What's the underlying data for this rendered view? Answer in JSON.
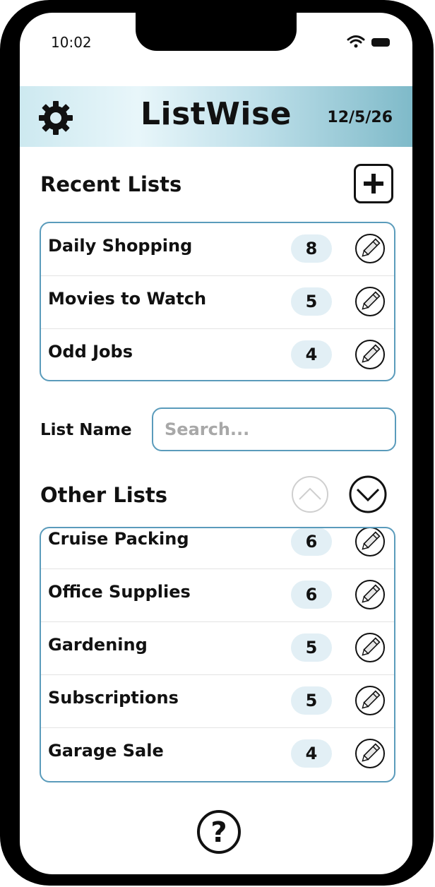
{
  "status_bar": {
    "time": "10:02"
  },
  "header": {
    "title": "ListWise",
    "date": "12/5/26",
    "settings_icon": "gear-icon"
  },
  "recent": {
    "title": "Recent Lists",
    "items": [
      {
        "label": "Daily Shopping",
        "count": "8"
      },
      {
        "label": "Movies to Watch",
        "count": "5"
      },
      {
        "label": "Odd Jobs",
        "count": "4"
      }
    ]
  },
  "filter": {
    "label": "List Name",
    "placeholder": "Search..."
  },
  "other": {
    "title": "Other Lists",
    "items": [
      {
        "label": "Cruise Packing",
        "count": "6"
      },
      {
        "label": "Office Supplies",
        "count": "6"
      },
      {
        "label": "Gardening",
        "count": "5"
      },
      {
        "label": "Subscriptions",
        "count": "5"
      },
      {
        "label": "Garage Sale",
        "count": "4"
      }
    ]
  },
  "colors": {
    "accent_border": "#5a9bbb",
    "count_bg": "#e2eff5",
    "header_gradient_end": "#7fbac9"
  }
}
